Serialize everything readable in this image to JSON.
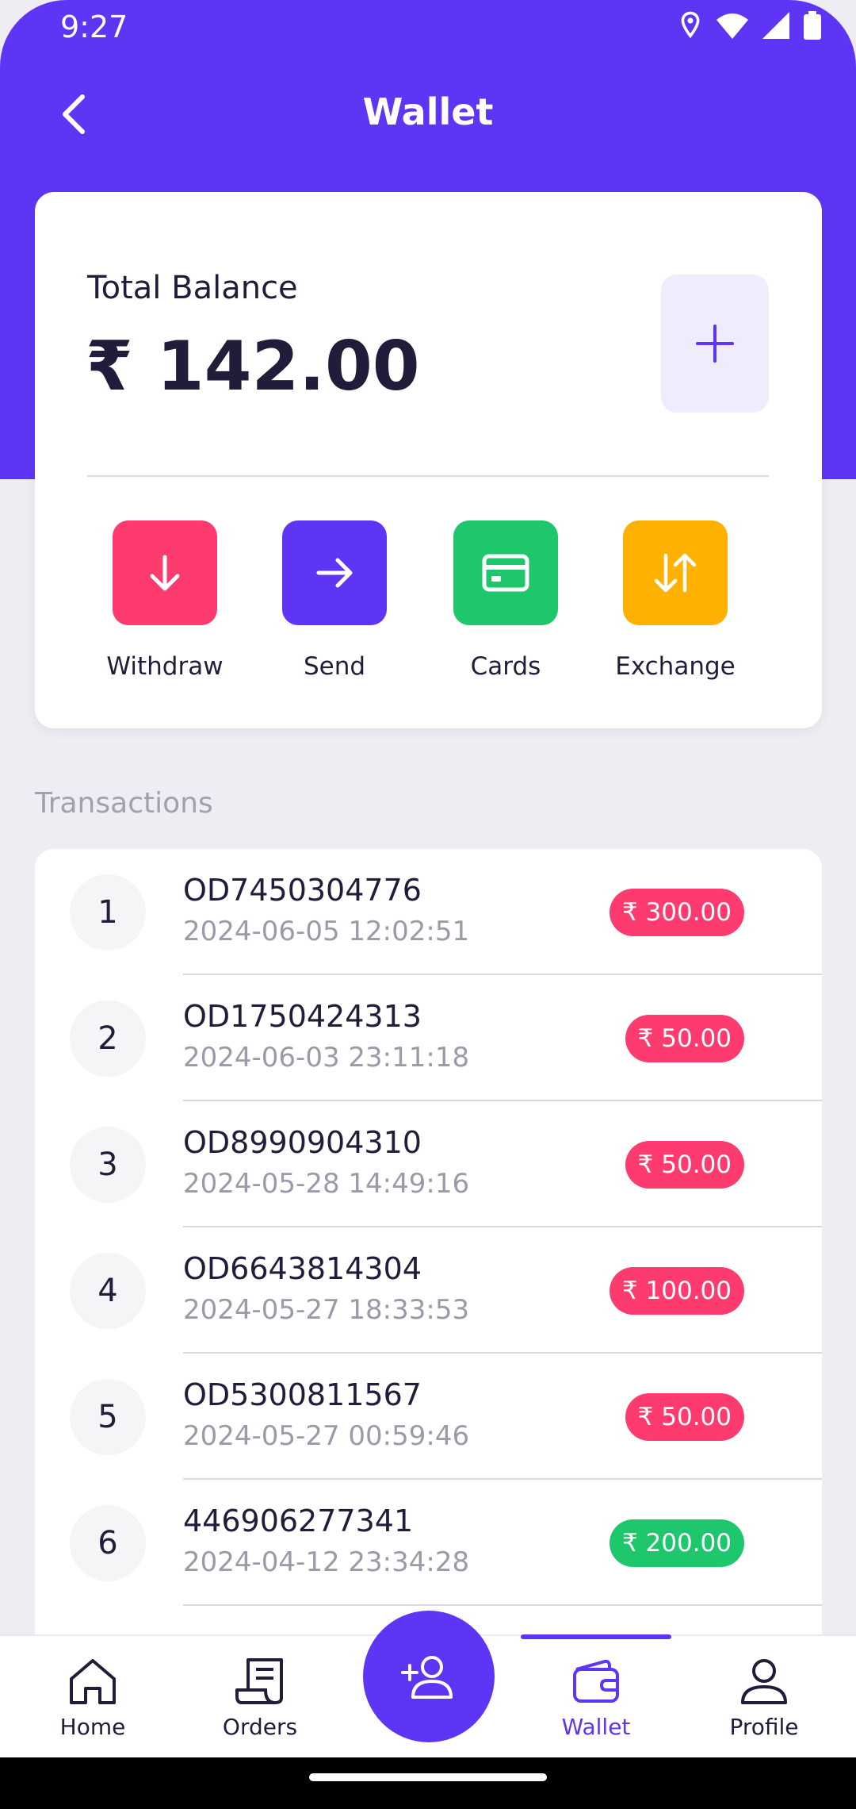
{
  "status": {
    "time": "9:27"
  },
  "appbar": {
    "title": "Wallet"
  },
  "balance": {
    "label": "Total Balance",
    "value": "₹ 142.00"
  },
  "actions": [
    {
      "label": "Withdraw",
      "color": "#fe3b6e",
      "icon": "arrow-down-icon"
    },
    {
      "label": "Send",
      "color": "#5f35f5",
      "icon": "arrow-right-icon"
    },
    {
      "label": "Cards",
      "color": "#1ec76b",
      "icon": "card-icon"
    },
    {
      "label": "Exchange",
      "color": "#feb100",
      "icon": "exchange-icon"
    }
  ],
  "transactions_title": "Transactions",
  "transactions": [
    {
      "index": "1",
      "order": "OD7450304776",
      "datetime": "2024-06-05 12:02:51",
      "amount": "₹ 300.00",
      "type": "debit"
    },
    {
      "index": "2",
      "order": "OD1750424313",
      "datetime": "2024-06-03 23:11:18",
      "amount": "₹ 50.00",
      "type": "debit"
    },
    {
      "index": "3",
      "order": "OD8990904310",
      "datetime": "2024-05-28 14:49:16",
      "amount": "₹ 50.00",
      "type": "debit"
    },
    {
      "index": "4",
      "order": "OD6643814304",
      "datetime": "2024-05-27 18:33:53",
      "amount": "₹ 100.00",
      "type": "debit"
    },
    {
      "index": "5",
      "order": "OD5300811567",
      "datetime": "2024-05-27 00:59:46",
      "amount": "₹ 50.00",
      "type": "debit"
    },
    {
      "index": "6",
      "order": "446906277341",
      "datetime": "2024-04-12 23:34:28",
      "amount": "₹ 200.00",
      "type": "credit"
    }
  ],
  "colors": {
    "primary": "#5f35f5",
    "debit": "#fe3b6e",
    "credit": "#1ec76b"
  },
  "nav": {
    "home": "Home",
    "orders": "Orders",
    "wallet": "Wallet",
    "profile": "Profile"
  }
}
